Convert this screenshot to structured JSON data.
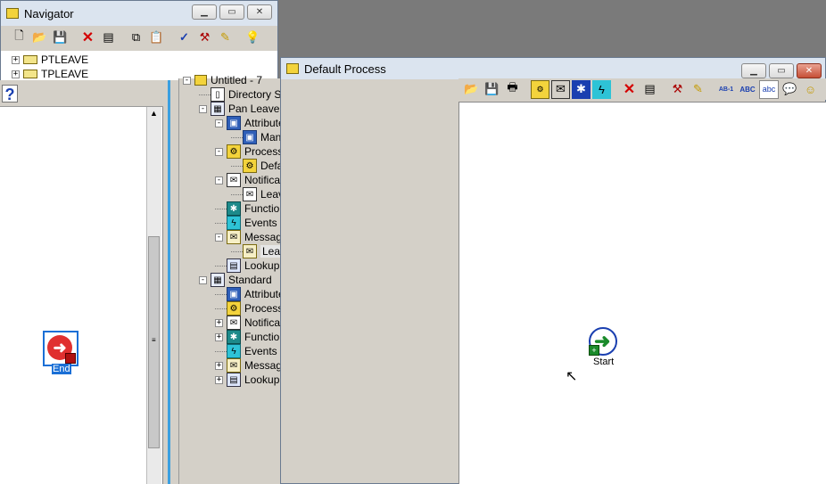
{
  "navigator": {
    "title": "Navigator",
    "items": [
      {
        "label": "PTLEAVE"
      },
      {
        "label": "TPLEAVE"
      }
    ],
    "help_glyph": "?"
  },
  "left_canvas": {
    "node_label": "End"
  },
  "tree": {
    "root_label": "Untitled - 7",
    "rows": [
      {
        "label": "Directory Service",
        "icon": "book"
      },
      {
        "label": "Pan Leave Approval",
        "icon": "itemtype"
      },
      {
        "label": "Attributes",
        "icon": "attr"
      },
      {
        "label": "Manager",
        "icon": "attr"
      },
      {
        "label": "Processes",
        "icon": "proc"
      },
      {
        "label": "Default Process",
        "icon": "proc"
      },
      {
        "label": "Notifications",
        "icon": "notif"
      },
      {
        "label": "Leave Request",
        "icon": "notif"
      },
      {
        "label": "Functions",
        "icon": "func"
      },
      {
        "label": "Events",
        "icon": "evt"
      },
      {
        "label": "Messages",
        "icon": "msg"
      },
      {
        "label": "Leave Request",
        "icon": "msg"
      },
      {
        "label": "Lookup Types",
        "icon": "lookup"
      },
      {
        "label": "Standard",
        "icon": "itemtype"
      },
      {
        "label": "Attributes",
        "icon": "attr"
      },
      {
        "label": "Processes",
        "icon": "proc"
      },
      {
        "label": "Notifications",
        "icon": "notif"
      },
      {
        "label": "Functions",
        "icon": "func"
      },
      {
        "label": "Events",
        "icon": "evt"
      },
      {
        "label": "Messages",
        "icon": "msg"
      },
      {
        "label": "Lookup Types",
        "icon": "lookup"
      }
    ]
  },
  "process_window": {
    "title": "Default Process",
    "toolbar_text": {
      "ab1": "AB-1",
      "abc_upper": "ABC",
      "abc_lower": "abc"
    },
    "start_label": "Start"
  }
}
